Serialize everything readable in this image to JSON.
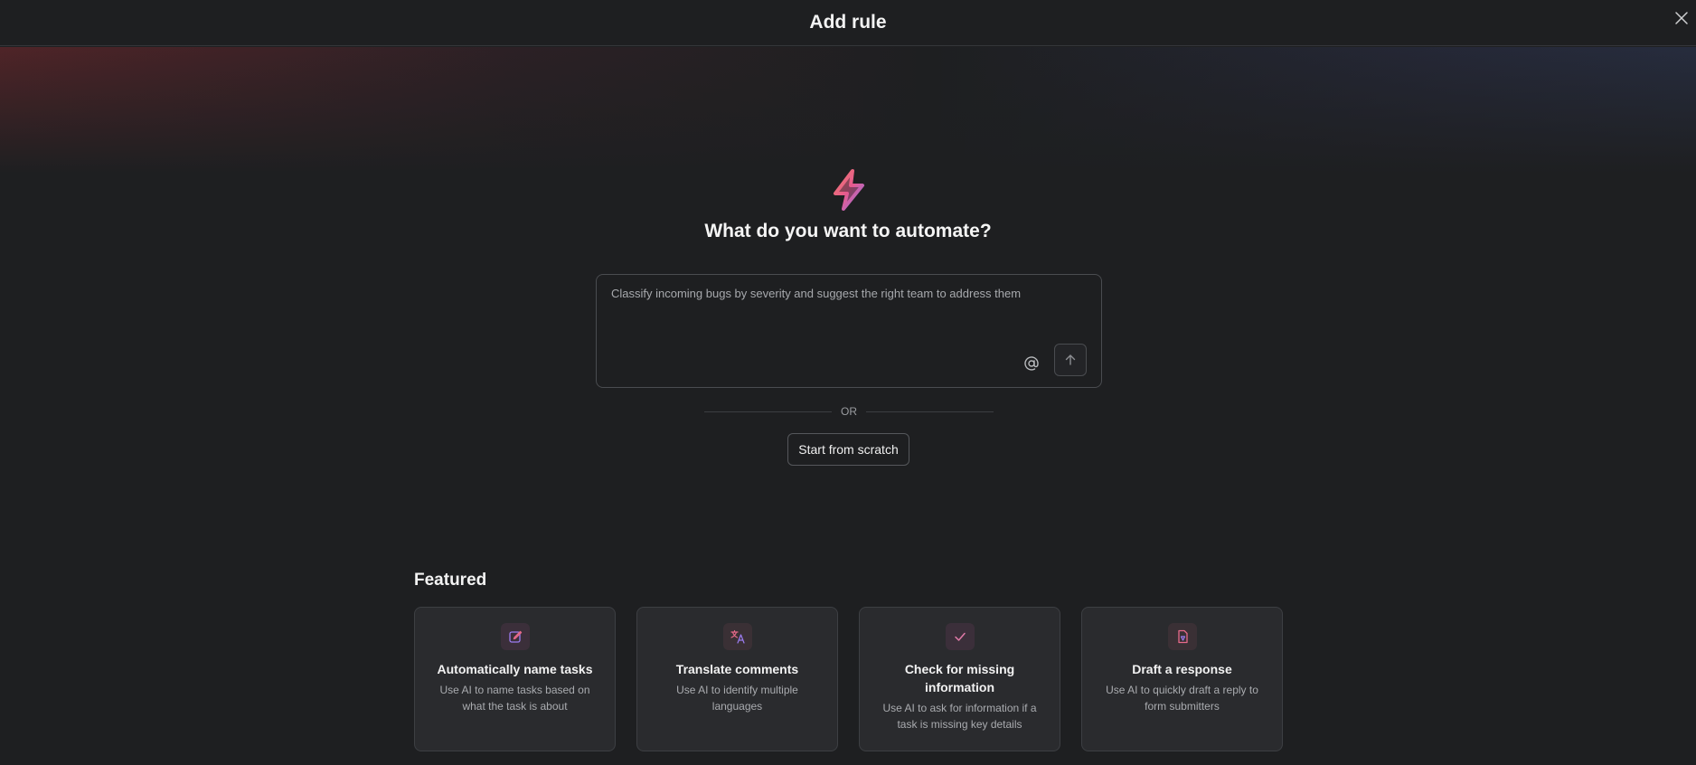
{
  "header": {
    "title": "Add rule",
    "close_icon": "close-icon"
  },
  "hero": {
    "icon": "lightning-bolt-icon",
    "title": "What do you want to automate?"
  },
  "prompt": {
    "placeholder": "Classify incoming bugs by severity and suggest the right team to address them",
    "value": "",
    "mention_icon": "at-sign-icon",
    "send_icon": "arrow-up-icon"
  },
  "divider": {
    "label": "OR"
  },
  "scratch_button": {
    "label": "Start from scratch"
  },
  "featured": {
    "title": "Featured",
    "cards": [
      {
        "icon": "edit-pencil-icon",
        "title": "Automatically name tasks",
        "description": "Use AI to name tasks based on what the task is about"
      },
      {
        "icon": "translate-icon",
        "title": "Translate comments",
        "description": "Use AI to identify multiple languages"
      },
      {
        "icon": "checkmark-icon",
        "title": "Check for missing information",
        "description": "Use AI to ask for information if a task is missing key details"
      },
      {
        "icon": "document-draft-icon",
        "title": "Draft a response",
        "description": "Use AI to quickly draft a reply to form submitters"
      }
    ]
  },
  "colors": {
    "background": "#1e1f21",
    "card_background": "#2a2b2e",
    "border": "#4a4c50",
    "accent_pink": "#e86a8a",
    "accent_purple": "#9b7cf0"
  }
}
